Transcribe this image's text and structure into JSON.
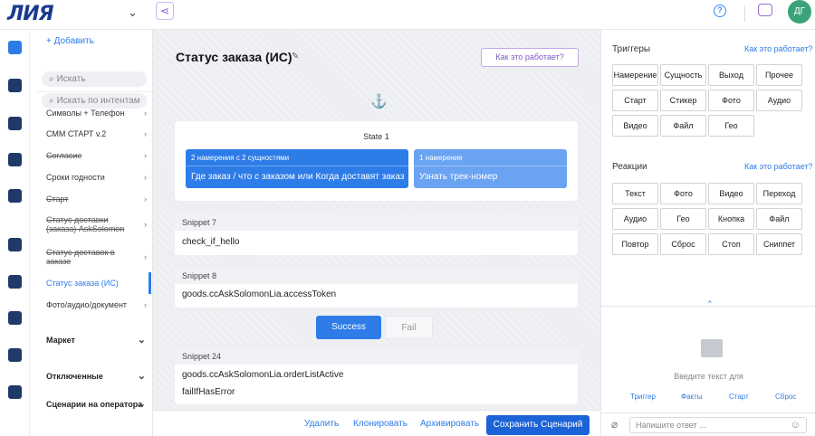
{
  "app": {
    "logo": "ЛИЯ",
    "user_initials": "ДГ"
  },
  "sidebar": {
    "add_label": "+ Добавить",
    "search_placeholder": "Искать",
    "intent_search_placeholder": "Искать по интентам",
    "items": [
      {
        "label": "Символы + Телефон",
        "strike": false
      },
      {
        "label": "СММ СТАРТ v.2",
        "strike": false
      },
      {
        "label": "Согласие",
        "strike": true
      },
      {
        "label": "Сроки годности",
        "strike": false
      },
      {
        "label": "Старт",
        "strike": true
      },
      {
        "label": "Статус доставки (заказа) AskSolomon",
        "strike": true
      },
      {
        "label": "Статус доставок в заказе",
        "strike": true
      },
      {
        "label": "Статус заказа (ИС)",
        "strike": false,
        "active": true
      },
      {
        "label": "Фото/аудио/документ",
        "strike": false
      }
    ],
    "sections": [
      "Маркет",
      "Отключенные",
      "Сценарии на оператора"
    ]
  },
  "main": {
    "title": "Статус заказа (ИС)",
    "how_it_works": "Как это работает?",
    "state": {
      "label": "State 1",
      "intent_a": {
        "header": "2 намерения с 2 сущностями",
        "text": "Где заказ / что с заказом или Когда доставят заказ"
      },
      "intent_b": {
        "header": "1 намерение",
        "text": "Узнать трек-номер"
      }
    },
    "snippets": [
      {
        "header": "Snippet 7",
        "lines": [
          "check_if_hello"
        ]
      },
      {
        "header": "Snippet 8",
        "lines": [
          "goods.ccAskSolomonLia.accessToken"
        ]
      },
      {
        "header": "Snippet 24",
        "lines": [
          "goods.ccAskSolomonLia.orderListActive",
          "failIfHasError"
        ]
      }
    ],
    "success_label": "Success",
    "fail_label": "Fail"
  },
  "bottom": {
    "delete": "Удалить",
    "clone": "Клонировать",
    "archive": "Архивировать",
    "save": "Сохранить Сценарий"
  },
  "right": {
    "triggers_title": "Триггеры",
    "triggers_link": "Как это работает?",
    "triggers": [
      "Намерение",
      "Сущность",
      "Выход",
      "Прочее",
      "Старт",
      "Стикер",
      "Фото",
      "Аудио",
      "Видео",
      "Файл",
      "Гео"
    ],
    "reactions_title": "Реакции",
    "reactions_link": "Как это работает?",
    "reactions": [
      "Текст",
      "Фото",
      "Видео",
      "Переход",
      "Аудио",
      "Гео",
      "Кнопка",
      "Файл",
      "Повтор",
      "Сброс",
      "Стоп",
      "Сниппет"
    ],
    "hint": "Введите текст для",
    "tabs": [
      "Триггер",
      "Факты",
      "Старт",
      "Сброс"
    ],
    "reply_placeholder": "Напишите ответ ..."
  },
  "colors": {
    "accent": "#2d7ce8",
    "save": "#1c63d8",
    "intent_dark": "#2d7ce8",
    "intent_light": "#6aa3f2",
    "purple": "#8a63d2"
  }
}
